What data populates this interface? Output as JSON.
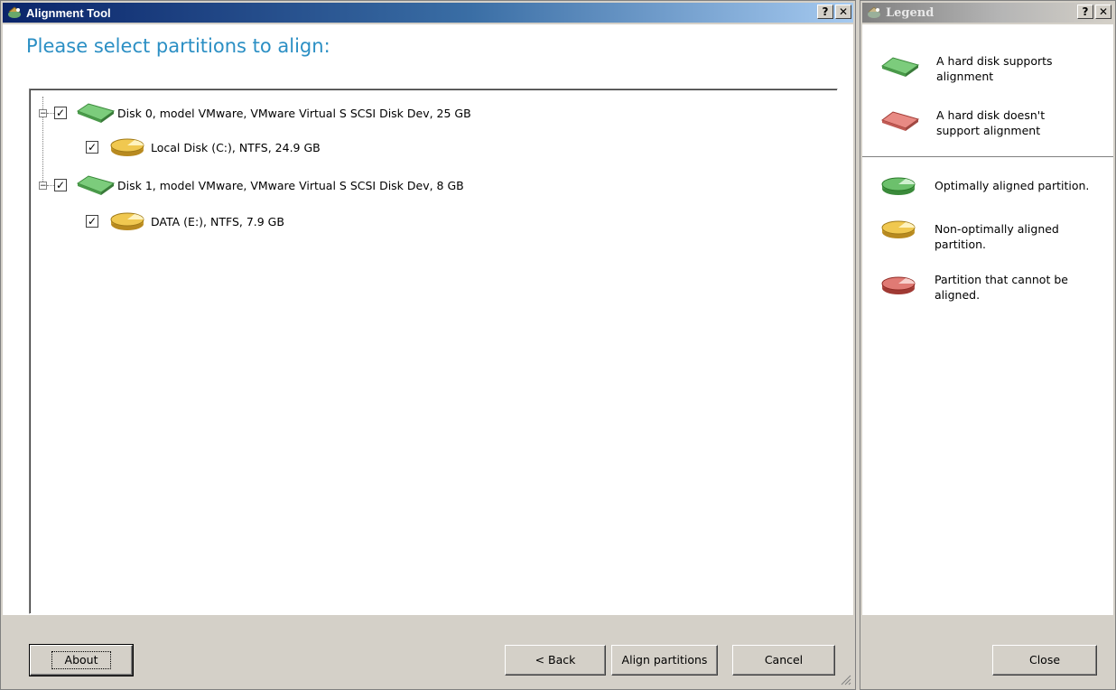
{
  "main_window": {
    "title": "Alignment Tool",
    "help_btn": "?",
    "close_btn": "✕",
    "heading": "Please select partitions to align:",
    "tree": [
      {
        "type": "disk",
        "label": "Disk 0, model VMware, VMware Virtual S SCSI Disk Dev, 25 GB",
        "checked": true
      },
      {
        "type": "partition",
        "label": "Local Disk (C:), NTFS, 24.9 GB",
        "checked": true
      },
      {
        "type": "disk",
        "label": "Disk 1, model VMware, VMware Virtual S SCSI Disk Dev, 8 GB",
        "checked": true
      },
      {
        "type": "partition",
        "label": "DATA (E:), NTFS, 7.9 GB",
        "checked": true
      }
    ],
    "buttons": {
      "about": "About",
      "back": "< Back",
      "align": "Align partitions",
      "cancel": "Cancel"
    }
  },
  "legend_window": {
    "title": "Legend",
    "help_btn": "?",
    "close_btn": "✕",
    "items": [
      {
        "icon": "green-disk-icon",
        "text": "A hard disk supports alignment"
      },
      {
        "icon": "red-disk-icon",
        "text": "A hard disk doesn't support alignment"
      },
      {
        "icon": "green-partition-icon",
        "text": "Optimally aligned partition."
      },
      {
        "icon": "yellow-partition-icon",
        "text": "Non-optimally aligned partition."
      },
      {
        "icon": "red-partition-icon",
        "text": "Partition that cannot be aligned."
      }
    ],
    "close_label": "Close"
  },
  "colors": {
    "accent_heading": "#2b8fc4",
    "title_active": "#0a246a",
    "disk_green": "#5dbb63",
    "disk_red": "#d9605a",
    "partition_yellow": "#e0b43a"
  }
}
